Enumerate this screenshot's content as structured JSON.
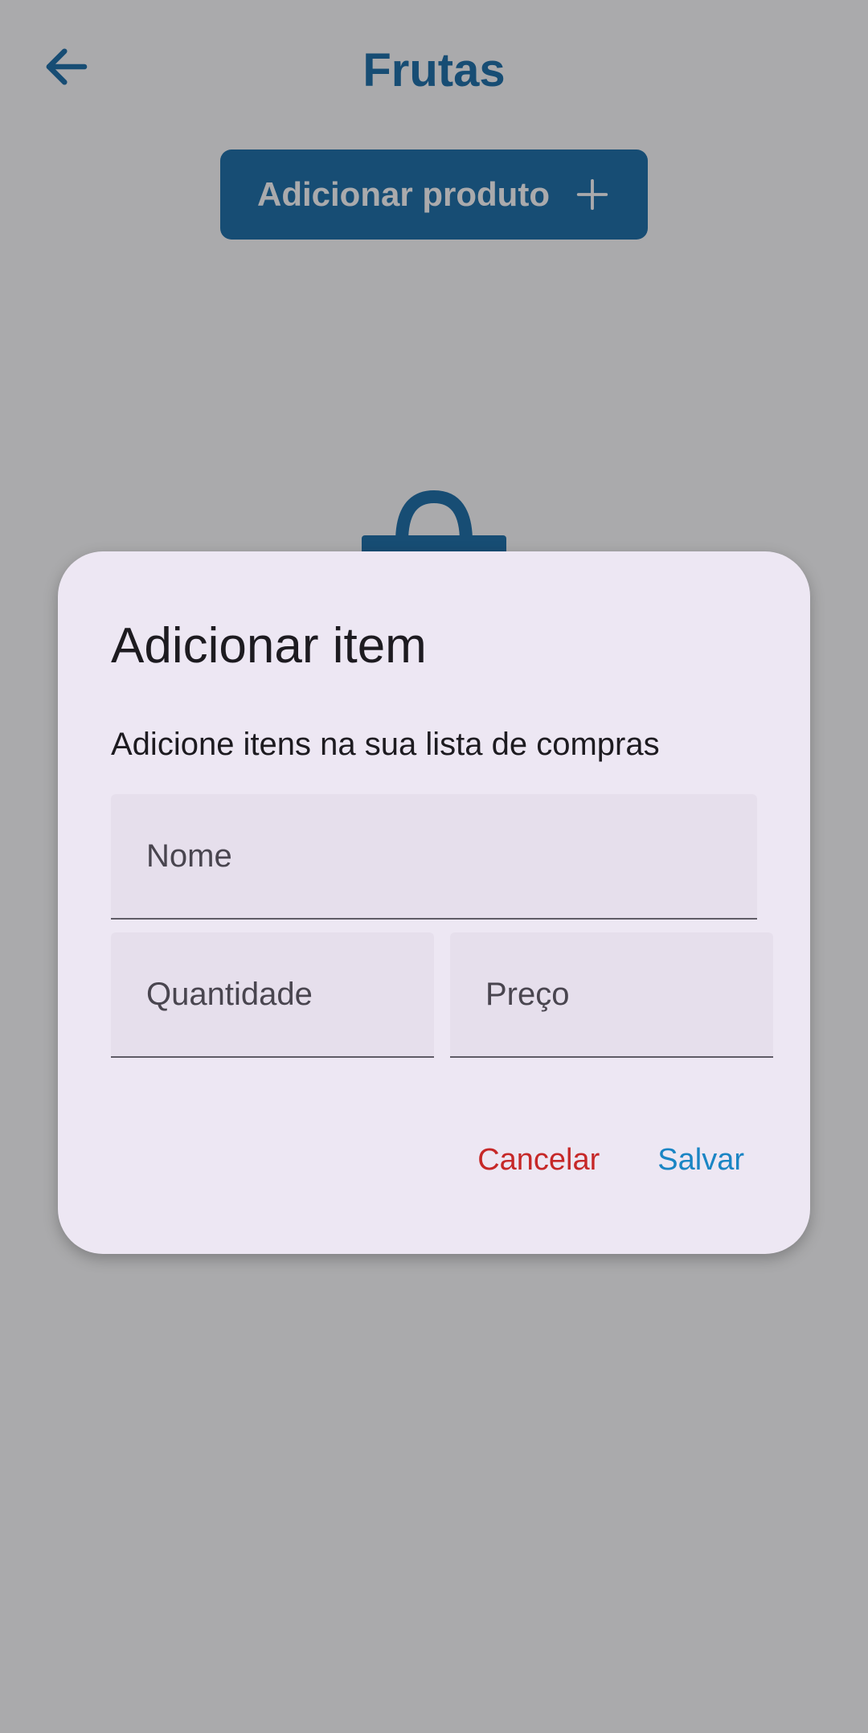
{
  "header": {
    "back_icon": "arrow-left-icon",
    "title": "Frutas"
  },
  "main": {
    "add_product_label": "Adicionar produto",
    "add_product_icon": "plus-icon",
    "empty_state_icon": "shopping-basket-icon"
  },
  "dialog": {
    "title": "Adicionar item",
    "subtitle": "Adicione itens na sua lista de compras",
    "fields": {
      "name": {
        "value": "",
        "placeholder": "Nome"
      },
      "quantity": {
        "value": "",
        "placeholder": "Quantidade"
      },
      "price": {
        "value": "",
        "placeholder": "Preço"
      }
    },
    "cancel_label": "Cancelar",
    "save_label": "Salvar"
  },
  "colors": {
    "primary": "#1a6ea8",
    "dialog_background": "#ede7f3",
    "field_background": "#e6dfec",
    "cancel": "#c62828",
    "save": "#1a85c4"
  }
}
